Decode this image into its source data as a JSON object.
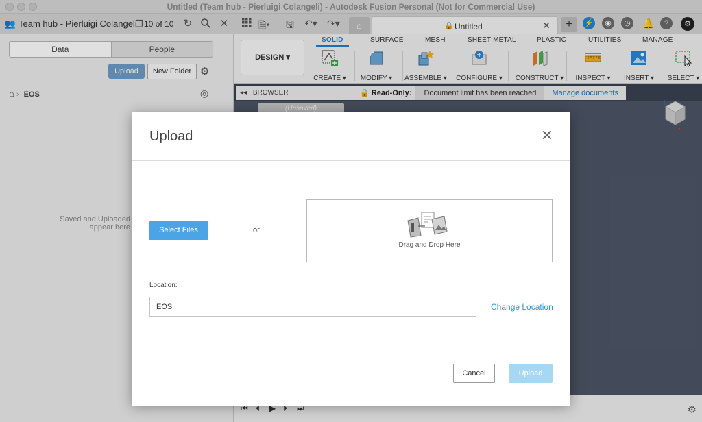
{
  "window": {
    "title": "Untitled (Team hub - Pierluigi Colangeli) - Autodesk Fusion Personal (Not for Commercial Use)"
  },
  "data_panel": {
    "team_name": "Team hub - Pierluigi Colangeli",
    "doc_count": "10 of 10",
    "tabs": [
      {
        "label": "Data"
      },
      {
        "label": "People"
      }
    ],
    "upload_label": "Upload",
    "new_folder_label": "New Folder",
    "breadcrumb": "EOS",
    "empty_line1": "Saved and Uploaded",
    "empty_line2": "appear here"
  },
  "doc_tab": {
    "title": "Untitled"
  },
  "ribbon": {
    "design_label": "DESIGN ▾",
    "tabs": [
      {
        "label": "SOLID"
      },
      {
        "label": "SURFACE"
      },
      {
        "label": "MESH"
      },
      {
        "label": "SHEET METAL"
      },
      {
        "label": "PLASTIC"
      },
      {
        "label": "UTILITIES"
      },
      {
        "label": "MANAGE"
      }
    ],
    "groups": [
      {
        "label": "CREATE ▾"
      },
      {
        "label": "MODIFY ▾"
      },
      {
        "label": "ASSEMBLE ▾"
      },
      {
        "label": "CONFIGURE ▾"
      },
      {
        "label": "CONSTRUCT ▾"
      },
      {
        "label": "INSPECT ▾"
      },
      {
        "label": "INSERT ▾"
      },
      {
        "label": "SELECT ▾"
      }
    ]
  },
  "browser_bar": {
    "label": "BROWSER",
    "readonly": "Read-Only:",
    "limit_message": "Document limit has been reached",
    "manage_label": "Manage documents",
    "unsaved_label": "(Unsaved)"
  },
  "modal": {
    "title": "Upload",
    "select_files_label": "Select Files",
    "or_text": "or",
    "dropzone_label": "Drag and Drop Here",
    "location_label": "Location:",
    "location_value": "EOS",
    "change_location_label": "Change Location",
    "cancel_label": "Cancel",
    "upload_label": "Upload"
  },
  "colors": {
    "accent_blue": "#4aa4e6",
    "upload_disabled": "#a6d8f3",
    "canvas": "#4d5566",
    "link": "#2a9ae0"
  }
}
